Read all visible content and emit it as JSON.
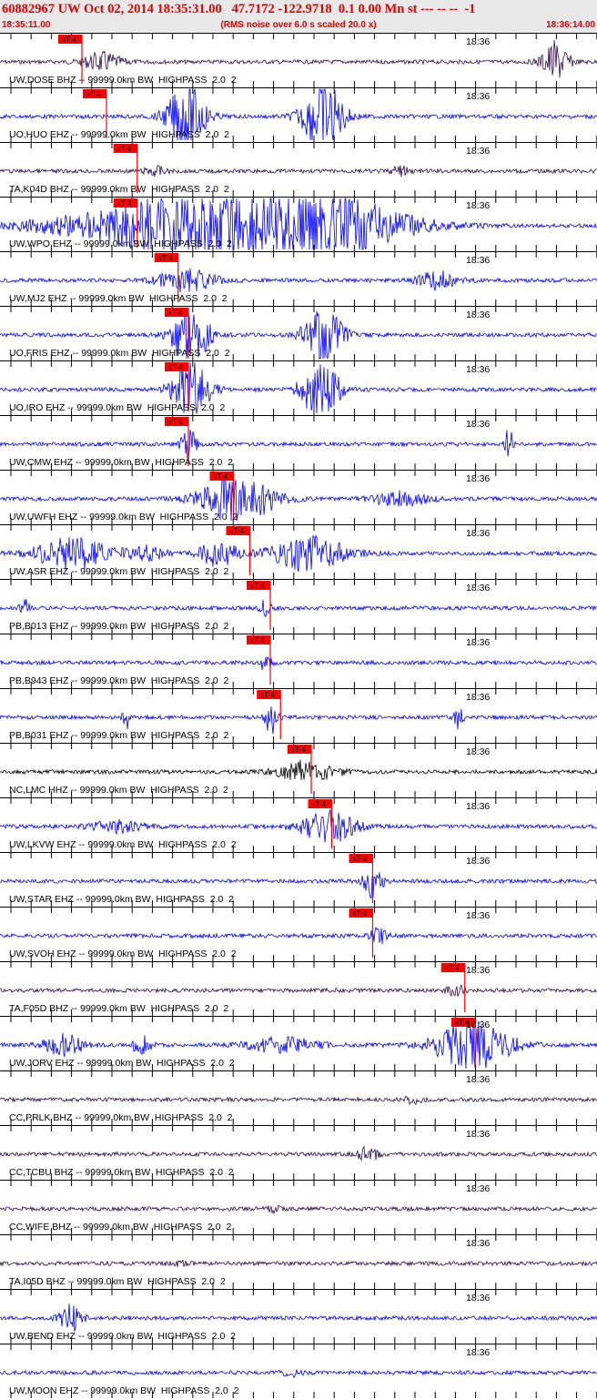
{
  "header": {
    "title": "60882967 UW Oct 02, 2014 18:35:31.00   47.7172 -122.9718  0.1 0.00 Mn st --- -- --  -1",
    "start_time": "18:35:11.00",
    "note": "(RMS noise over 6.0 s scaled 20.0 x)",
    "end_time": "18:36:14.00"
  },
  "time_tick_label": "18:36",
  "pick_label": "xT-4",
  "colors": {
    "header_text": "#e00000",
    "trace_blue": "#0000ff",
    "trace_dark": "#2a0a4a",
    "trace_black": "#000000",
    "pick": "#ff0000"
  },
  "traces": [
    {
      "label": "UW,DOSE BHZ -- 99999.0km BW  HIGHPASS  2.0  2",
      "color": "dark",
      "pick": 0.48
    },
    {
      "label": "UO,HUO EHZ -- 99999.0km BW  HIGHPASS  2.0  2",
      "color": "blue",
      "pick": 0.6
    },
    {
      "label": "TA,K04D BHZ -- 99999.0km BW  HIGHPASS  2.0  2",
      "color": "dark",
      "pick": 0.75
    },
    {
      "label": "UW,WPO EHZ -- 99999.0km BW  HIGHPASS  2.0  2",
      "color": "blue",
      "pick": 0.75
    },
    {
      "label": "UW,MJ2 EHZ -- 99999.0km BW  HIGHPASS  2.0  2",
      "color": "blue",
      "pick": 0.95
    },
    {
      "label": "UO,FRIS EHZ -- 99999.0km BW  HIGHPASS  2.0  2",
      "color": "blue",
      "pick": 1.0
    },
    {
      "label": "UO,IRO EHZ -- 99999.0km BW  HIGHPASS  2.0  2",
      "color": "blue",
      "pick": 1.0
    },
    {
      "label": "UW,CMW EHZ -- 99999.0km BW  HIGHPASS  2.0  2",
      "color": "blue",
      "pick": 1.0
    },
    {
      "label": "UW,UWFH EHZ -- 99999.0km BW  HIGHPASS  2.0  2",
      "color": "blue",
      "pick": 1.22
    },
    {
      "label": "UW,ASR EHZ -- 99999.0km BW  HIGHPASS  2.0  2",
      "color": "blue",
      "pick": 1.3
    },
    {
      "label": "PB,B013 EHZ -- 99999.0km BW  HIGHPASS  2.0  2",
      "color": "blue",
      "pick": 1.4
    },
    {
      "label": "PB,B943 EHZ -- 99999.0km BW  HIGHPASS  2.0  2",
      "color": "blue",
      "pick": 1.4
    },
    {
      "label": "PB,B031 EHZ -- 99999.0km BW  HIGHPASS  2.0  2",
      "color": "blue",
      "pick": 1.45
    },
    {
      "label": "NC,LMC HHZ -- 99999.0km BW  HIGHPASS  2.0  2",
      "color": "black",
      "pick": 1.6
    },
    {
      "label": "UW,LKVW EHZ -- 99999.0km BW  HIGHPASS  2.0  2",
      "color": "blue",
      "pick": 1.7
    },
    {
      "label": "UW,STAR EHZ -- 99999.0km BW  HIGHPASS  2.0  2",
      "color": "blue",
      "pick": 1.9
    },
    {
      "label": "UW,SVOH EHZ -- 99999.0km BW  HIGHPASS  2.0  2",
      "color": "blue",
      "pick": 1.9
    },
    {
      "label": "TA,F05D BHZ -- 99999.0km BW  HIGHPASS  2.0  2",
      "color": "dark",
      "pick": 2.35
    },
    {
      "label": "UW,JORV EHZ -- 99999.0km BW  HIGHPASS  2.0  2",
      "color": "blue",
      "pick": 2.4
    },
    {
      "label": "CC,PRLK BHZ -- 99999.0km BW  HIGHPASS  2.0  2",
      "color": "dark",
      "pick": null
    },
    {
      "label": "CC,TCBU BHZ -- 99999.0km BW  HIGHPASS  2.0  2",
      "color": "dark",
      "pick": null
    },
    {
      "label": "CC,WIFE BHZ -- 99999.0km BW  HIGHPASS  2.0  2",
      "color": "dark",
      "pick": null
    },
    {
      "label": "TA,I05D BHZ -- 99999.0km BW  HIGHPASS  2.0  2",
      "color": "dark",
      "pick": null
    },
    {
      "label": "UW,BEND EHZ -- 99999.0km BW  HIGHPASS  2.0  2",
      "color": "blue",
      "pick": null
    },
    {
      "label": "UW,MOON EHZ -- 99999.0km BW  HIGHPASS  2.0  2",
      "color": "blue",
      "pick": null
    }
  ]
}
